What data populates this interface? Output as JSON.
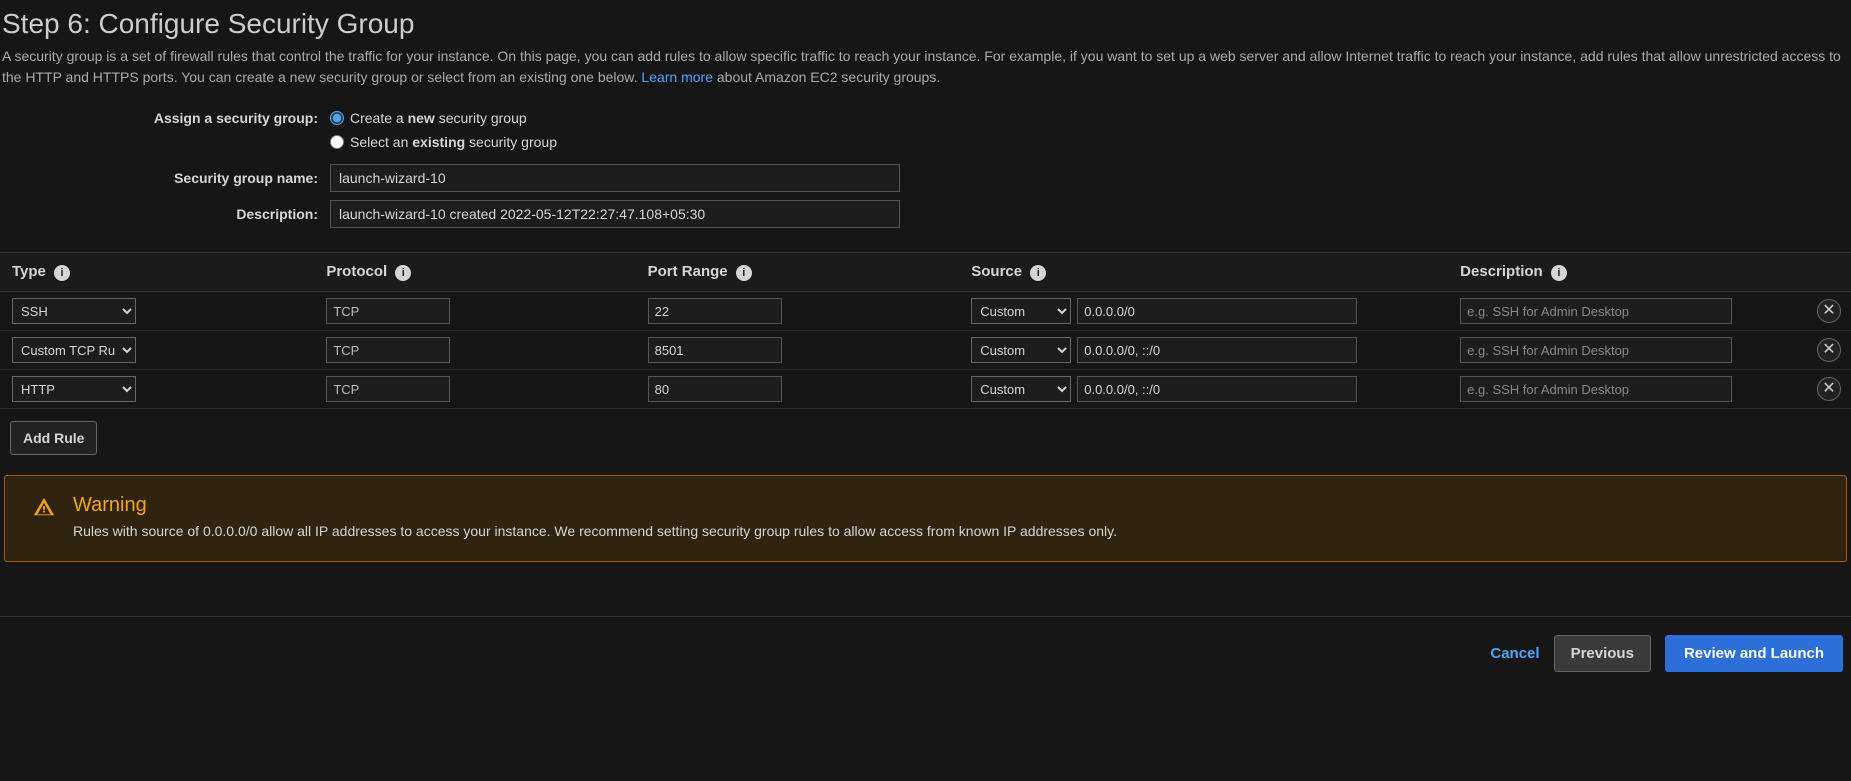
{
  "header": {
    "title": "Step 6: Configure Security Group",
    "description_pre": "A security group is a set of firewall rules that control the traffic for your instance. On this page, you can add rules to allow specific traffic to reach your instance. For example, if you want to set up a web server and allow Internet traffic to reach your instance, add rules that allow unrestricted access to the HTTP and HTTPS ports. You can create a new security group or select from an existing one below. ",
    "learn_more": "Learn more",
    "description_post": " about Amazon EC2 security groups."
  },
  "form": {
    "assign_label": "Assign a security group:",
    "radio_create_pre": "Create a ",
    "radio_create_bold": "new",
    "radio_create_post": " security group",
    "radio_existing_pre": "Select an ",
    "radio_existing_bold": "existing",
    "radio_existing_post": " security group",
    "name_label": "Security group name:",
    "name_value": "launch-wizard-10",
    "desc_label": "Description:",
    "desc_value": "launch-wizard-10 created 2022-05-12T22:27:47.108+05:30"
  },
  "table": {
    "headers": {
      "type": "Type",
      "protocol": "Protocol",
      "port": "Port Range",
      "source": "Source",
      "description": "Description"
    },
    "source_option": "Custom",
    "desc_placeholder": "e.g. SSH for Admin Desktop",
    "rows": [
      {
        "type": "SSH",
        "protocol": "TCP",
        "port": "22",
        "cidr": "0.0.0.0/0",
        "description": ""
      },
      {
        "type": "Custom TCP Rule",
        "protocol": "TCP",
        "port": "8501",
        "cidr": "0.0.0.0/0, ::/0",
        "description": ""
      },
      {
        "type": "HTTP",
        "protocol": "TCP",
        "port": "80",
        "cidr": "0.0.0.0/0, ::/0",
        "description": ""
      }
    ],
    "add_rule": "Add Rule"
  },
  "warning": {
    "title": "Warning",
    "text": "Rules with source of 0.0.0.0/0 allow all IP addresses to access your instance. We recommend setting security group rules to allow access from known IP addresses only."
  },
  "footer": {
    "cancel": "Cancel",
    "previous": "Previous",
    "review": "Review and Launch"
  }
}
